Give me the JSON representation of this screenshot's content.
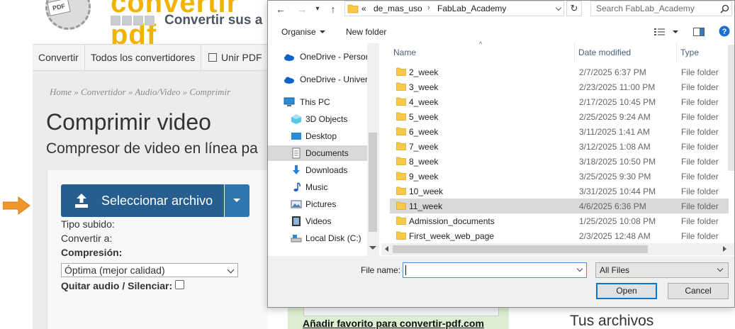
{
  "site": {
    "logo_pdf": "PDF",
    "logo_title": "convertir pdf",
    "tagline": "Convertir sus a",
    "nav": [
      "Convertir",
      "Todos los convertidores",
      "Unir PDF"
    ],
    "breadcrumb": "Home » Convertidor » Audio/Video » Comprimir",
    "title": "Comprimir video",
    "subtitle": "Compresor de video en línea pa",
    "select_button": "Seleccionar archivo",
    "labels": {
      "tipo": "Tipo subido:",
      "convertir": "Convertir a:",
      "compresion": "Compresión:",
      "quitar_audio": "Quitar audio / Silenciar:"
    },
    "compression_value": "Óptima (mejor calidad)",
    "favorite_link": "Añadir favorito para convertir-pdf.com",
    "your_files": "Tus archivos",
    "accent_color": "#265f8f",
    "arrow_color": "#f0962a"
  },
  "dialog": {
    "breadcrumb": [
      "«",
      "de_mas_uso",
      "FabLab_Academy"
    ],
    "search_placeholder": "Search FabLab_Academy",
    "toolbar": {
      "organise": "Organise",
      "new_folder": "New folder"
    },
    "nav": [
      {
        "label": "OneDrive - Persor",
        "icon": "cloud-icon"
      },
      {
        "label": "OneDrive - Univer",
        "icon": "cloud-icon"
      },
      {
        "label": "This PC",
        "icon": "computer-icon"
      },
      {
        "label": "3D Objects",
        "icon": "cube-icon"
      },
      {
        "label": "Desktop",
        "icon": "desktop-icon"
      },
      {
        "label": "Documents",
        "icon": "document-icon",
        "selected": true
      },
      {
        "label": "Downloads",
        "icon": "download-icon"
      },
      {
        "label": "Music",
        "icon": "music-icon"
      },
      {
        "label": "Pictures",
        "icon": "pictures-icon"
      },
      {
        "label": "Videos",
        "icon": "video-icon"
      },
      {
        "label": "Local Disk (C:)",
        "icon": "disk-icon"
      }
    ],
    "columns": {
      "name": "Name",
      "date": "Date modified",
      "type": "Type"
    },
    "files": [
      {
        "name": "2_week",
        "date": "2/7/2025 6:37 PM",
        "type": "File folder"
      },
      {
        "name": "3_week",
        "date": "2/23/2025 11:00 PM",
        "type": "File folder"
      },
      {
        "name": "4_week",
        "date": "2/17/2025 10:45 PM",
        "type": "File folder"
      },
      {
        "name": "5_week",
        "date": "2/25/2025 9:24 AM",
        "type": "File folder"
      },
      {
        "name": "6_week",
        "date": "3/11/2025 1:41 AM",
        "type": "File folder"
      },
      {
        "name": "7_week",
        "date": "3/12/2025 1:08 AM",
        "type": "File folder"
      },
      {
        "name": "8_week",
        "date": "3/18/2025 10:50 PM",
        "type": "File folder"
      },
      {
        "name": "9_week",
        "date": "3/25/2025 9:30 PM",
        "type": "File folder"
      },
      {
        "name": "10_week",
        "date": "3/31/2025 10:44 PM",
        "type": "File folder"
      },
      {
        "name": "11_week",
        "date": "4/6/2025 6:36 PM",
        "type": "File folder",
        "selected": true
      },
      {
        "name": "Admission_documents",
        "date": "1/25/2025 10:08 PM",
        "type": "File folder"
      },
      {
        "name": "First_week_web_page",
        "date": "2/3/2025 12:48 AM",
        "type": "File folder"
      }
    ],
    "file_name_label": "File name:",
    "file_name_value": "",
    "filter": "All Files",
    "open": "Open",
    "cancel": "Cancel",
    "folder_color": "#f7c948"
  }
}
